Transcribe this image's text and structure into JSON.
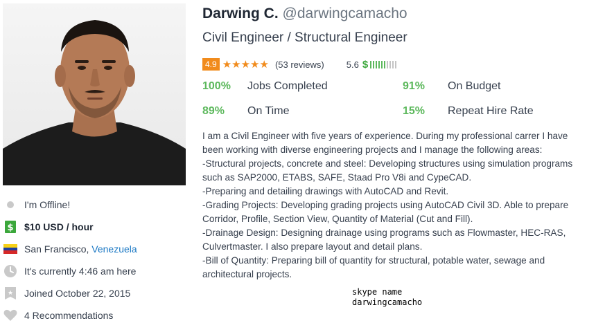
{
  "profile": {
    "name": "Darwing C.",
    "handle": "@darwingcamacho",
    "headline": "Civil Engineer / Structural Engineer",
    "rating": "4.9",
    "stars": 5,
    "reviews": "(53 reviews)",
    "earnings_score": "5.6",
    "earnings_symbol": "$",
    "earnings_level": 0.6
  },
  "stats": [
    {
      "pct": "100%",
      "label": "Jobs Completed"
    },
    {
      "pct": "91%",
      "label": "On Budget"
    },
    {
      "pct": "89%",
      "label": "On Time"
    },
    {
      "pct": "15%",
      "label": "Repeat Hire Rate"
    }
  ],
  "info": {
    "status": "I'm Offline!",
    "rate": "$10 USD / hour",
    "city": "San Francisco,",
    "country": "Venezuela",
    "local_time": "It's currently 4:46 am here",
    "joined": "Joined October 22, 2015",
    "recommendations": "4 Recommendations"
  },
  "description": "I am a Civil Engineer with five years of experience. During my professional carrer I have\nbeen working with diverse engineering projects and I manage the following areas:\n-Structural projects, concrete and steel: Developing structures using simulation programs\nsuch as SAP2000, ETABS, SAFE, Staad Pro V8i and CypeCAD.\n-Preparing and detailing drawings with AutoCAD and Revit.\n-Grading Projects: Developing grading projects using AutoCAD Civil 3D. Able to prepare\nCorridor, Profile, Section View, Quantity of Material (Cut and Fill).\n-Drainage Design: Designing drainage using programs such as Flowmaster, HEC-RAS,\nCulvertmaster. I also prepare layout and detail plans.\n-Bill of Quantity: Preparing bill of quantity for structural, potable water, sewage and\narchitectural projects.",
  "skype": {
    "label": "skype name",
    "value": "darwingcamacho"
  },
  "colors": {
    "accent_orange": "#f18b1c",
    "stat_green": "#5cb85c",
    "link_blue": "#1b78c4",
    "icon_gray": "#c9c9c9"
  },
  "icons": [
    "offline-dot-icon",
    "dollar-icon",
    "venezuela-flag-icon",
    "clock-icon",
    "badge-icon",
    "heart-icon",
    "star-icon"
  ]
}
